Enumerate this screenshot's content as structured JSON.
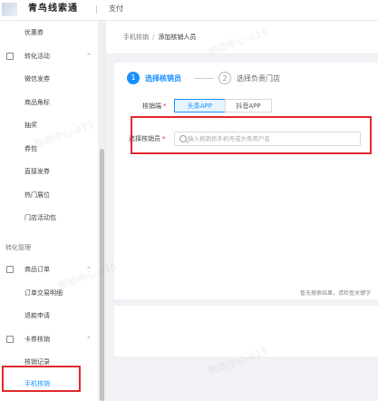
{
  "header": {
    "brand": "青鸟线索通",
    "tab": "支付",
    "logo_icon": "app-logo-icon"
  },
  "sidebar": {
    "items": [
      {
        "label": "优惠券"
      },
      {
        "label": "转化活动",
        "icon": "activity-icon",
        "chevron": "⌃"
      },
      {
        "label": "微信发券"
      },
      {
        "label": "商品角标"
      },
      {
        "label": "抽奖"
      },
      {
        "label": "券包"
      },
      {
        "label": "直接发券"
      },
      {
        "label": "热门展位"
      },
      {
        "label": "门店活动包"
      },
      {
        "label": "转化管理"
      },
      {
        "label": "商品订单",
        "icon": "order-icon",
        "chevron": "⌃"
      },
      {
        "label": "订单交易明细"
      },
      {
        "label": "退款申请"
      },
      {
        "label": "卡券核销",
        "icon": "ticket-icon",
        "chevron": "⌃"
      },
      {
        "label": "核销记录"
      },
      {
        "label": "手机核销"
      }
    ]
  },
  "breadcrumb": {
    "parent": "手机核销",
    "separator": "/",
    "current": "添加核销人员"
  },
  "steps": [
    {
      "num": "1",
      "label": "选择核销员"
    },
    {
      "num": "2",
      "label": "选择负责门店"
    }
  ],
  "form": {
    "platform_label": "核销端",
    "platform_options": [
      "头条APP",
      "抖音APP"
    ],
    "selected_platform": "头条APP",
    "verifier_label": "选择核销员",
    "required_mark": "*",
    "search_placeholder": "输入核销员手机号或头条用户名",
    "search_value": ""
  },
  "empty_text": "暂无搜索结果，请检查关键字",
  "watermark": "帮助中心-e15",
  "colors": {
    "accent": "#1890ff",
    "highlight": "#e0282e"
  }
}
